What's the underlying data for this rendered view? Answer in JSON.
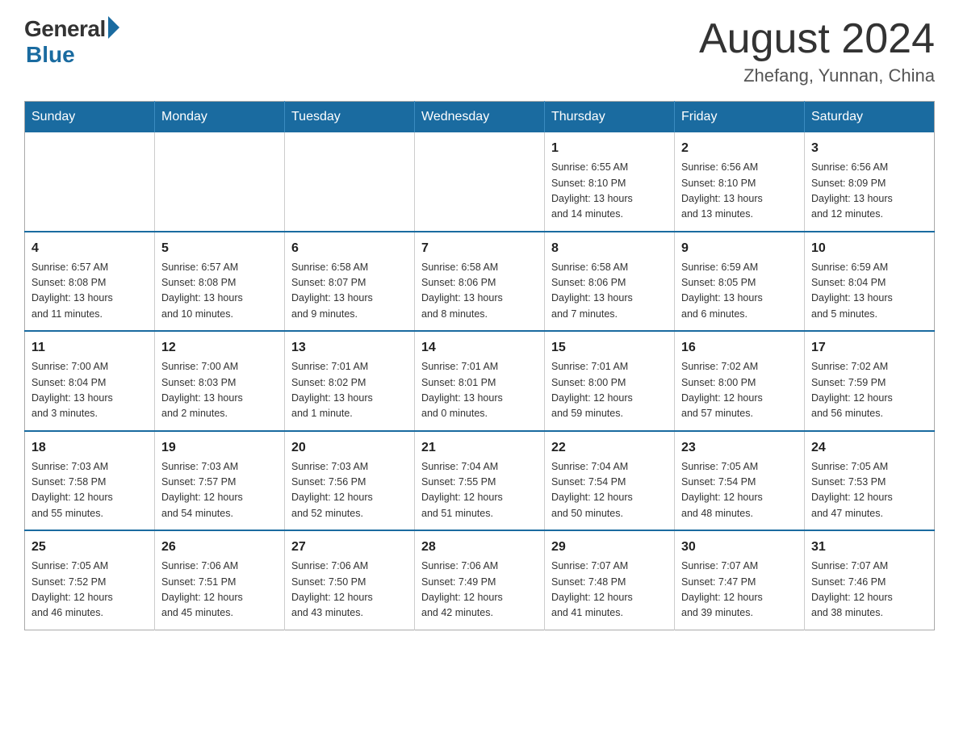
{
  "header": {
    "logo_general": "General",
    "logo_blue": "Blue",
    "title": "August 2024",
    "subtitle": "Zhefang, Yunnan, China"
  },
  "days_of_week": [
    "Sunday",
    "Monday",
    "Tuesday",
    "Wednesday",
    "Thursday",
    "Friday",
    "Saturday"
  ],
  "weeks": [
    [
      {
        "day": "",
        "info": ""
      },
      {
        "day": "",
        "info": ""
      },
      {
        "day": "",
        "info": ""
      },
      {
        "day": "",
        "info": ""
      },
      {
        "day": "1",
        "info": "Sunrise: 6:55 AM\nSunset: 8:10 PM\nDaylight: 13 hours\nand 14 minutes."
      },
      {
        "day": "2",
        "info": "Sunrise: 6:56 AM\nSunset: 8:10 PM\nDaylight: 13 hours\nand 13 minutes."
      },
      {
        "day": "3",
        "info": "Sunrise: 6:56 AM\nSunset: 8:09 PM\nDaylight: 13 hours\nand 12 minutes."
      }
    ],
    [
      {
        "day": "4",
        "info": "Sunrise: 6:57 AM\nSunset: 8:08 PM\nDaylight: 13 hours\nand 11 minutes."
      },
      {
        "day": "5",
        "info": "Sunrise: 6:57 AM\nSunset: 8:08 PM\nDaylight: 13 hours\nand 10 minutes."
      },
      {
        "day": "6",
        "info": "Sunrise: 6:58 AM\nSunset: 8:07 PM\nDaylight: 13 hours\nand 9 minutes."
      },
      {
        "day": "7",
        "info": "Sunrise: 6:58 AM\nSunset: 8:06 PM\nDaylight: 13 hours\nand 8 minutes."
      },
      {
        "day": "8",
        "info": "Sunrise: 6:58 AM\nSunset: 8:06 PM\nDaylight: 13 hours\nand 7 minutes."
      },
      {
        "day": "9",
        "info": "Sunrise: 6:59 AM\nSunset: 8:05 PM\nDaylight: 13 hours\nand 6 minutes."
      },
      {
        "day": "10",
        "info": "Sunrise: 6:59 AM\nSunset: 8:04 PM\nDaylight: 13 hours\nand 5 minutes."
      }
    ],
    [
      {
        "day": "11",
        "info": "Sunrise: 7:00 AM\nSunset: 8:04 PM\nDaylight: 13 hours\nand 3 minutes."
      },
      {
        "day": "12",
        "info": "Sunrise: 7:00 AM\nSunset: 8:03 PM\nDaylight: 13 hours\nand 2 minutes."
      },
      {
        "day": "13",
        "info": "Sunrise: 7:01 AM\nSunset: 8:02 PM\nDaylight: 13 hours\nand 1 minute."
      },
      {
        "day": "14",
        "info": "Sunrise: 7:01 AM\nSunset: 8:01 PM\nDaylight: 13 hours\nand 0 minutes."
      },
      {
        "day": "15",
        "info": "Sunrise: 7:01 AM\nSunset: 8:00 PM\nDaylight: 12 hours\nand 59 minutes."
      },
      {
        "day": "16",
        "info": "Sunrise: 7:02 AM\nSunset: 8:00 PM\nDaylight: 12 hours\nand 57 minutes."
      },
      {
        "day": "17",
        "info": "Sunrise: 7:02 AM\nSunset: 7:59 PM\nDaylight: 12 hours\nand 56 minutes."
      }
    ],
    [
      {
        "day": "18",
        "info": "Sunrise: 7:03 AM\nSunset: 7:58 PM\nDaylight: 12 hours\nand 55 minutes."
      },
      {
        "day": "19",
        "info": "Sunrise: 7:03 AM\nSunset: 7:57 PM\nDaylight: 12 hours\nand 54 minutes."
      },
      {
        "day": "20",
        "info": "Sunrise: 7:03 AM\nSunset: 7:56 PM\nDaylight: 12 hours\nand 52 minutes."
      },
      {
        "day": "21",
        "info": "Sunrise: 7:04 AM\nSunset: 7:55 PM\nDaylight: 12 hours\nand 51 minutes."
      },
      {
        "day": "22",
        "info": "Sunrise: 7:04 AM\nSunset: 7:54 PM\nDaylight: 12 hours\nand 50 minutes."
      },
      {
        "day": "23",
        "info": "Sunrise: 7:05 AM\nSunset: 7:54 PM\nDaylight: 12 hours\nand 48 minutes."
      },
      {
        "day": "24",
        "info": "Sunrise: 7:05 AM\nSunset: 7:53 PM\nDaylight: 12 hours\nand 47 minutes."
      }
    ],
    [
      {
        "day": "25",
        "info": "Sunrise: 7:05 AM\nSunset: 7:52 PM\nDaylight: 12 hours\nand 46 minutes."
      },
      {
        "day": "26",
        "info": "Sunrise: 7:06 AM\nSunset: 7:51 PM\nDaylight: 12 hours\nand 45 minutes."
      },
      {
        "day": "27",
        "info": "Sunrise: 7:06 AM\nSunset: 7:50 PM\nDaylight: 12 hours\nand 43 minutes."
      },
      {
        "day": "28",
        "info": "Sunrise: 7:06 AM\nSunset: 7:49 PM\nDaylight: 12 hours\nand 42 minutes."
      },
      {
        "day": "29",
        "info": "Sunrise: 7:07 AM\nSunset: 7:48 PM\nDaylight: 12 hours\nand 41 minutes."
      },
      {
        "day": "30",
        "info": "Sunrise: 7:07 AM\nSunset: 7:47 PM\nDaylight: 12 hours\nand 39 minutes."
      },
      {
        "day": "31",
        "info": "Sunrise: 7:07 AM\nSunset: 7:46 PM\nDaylight: 12 hours\nand 38 minutes."
      }
    ]
  ]
}
